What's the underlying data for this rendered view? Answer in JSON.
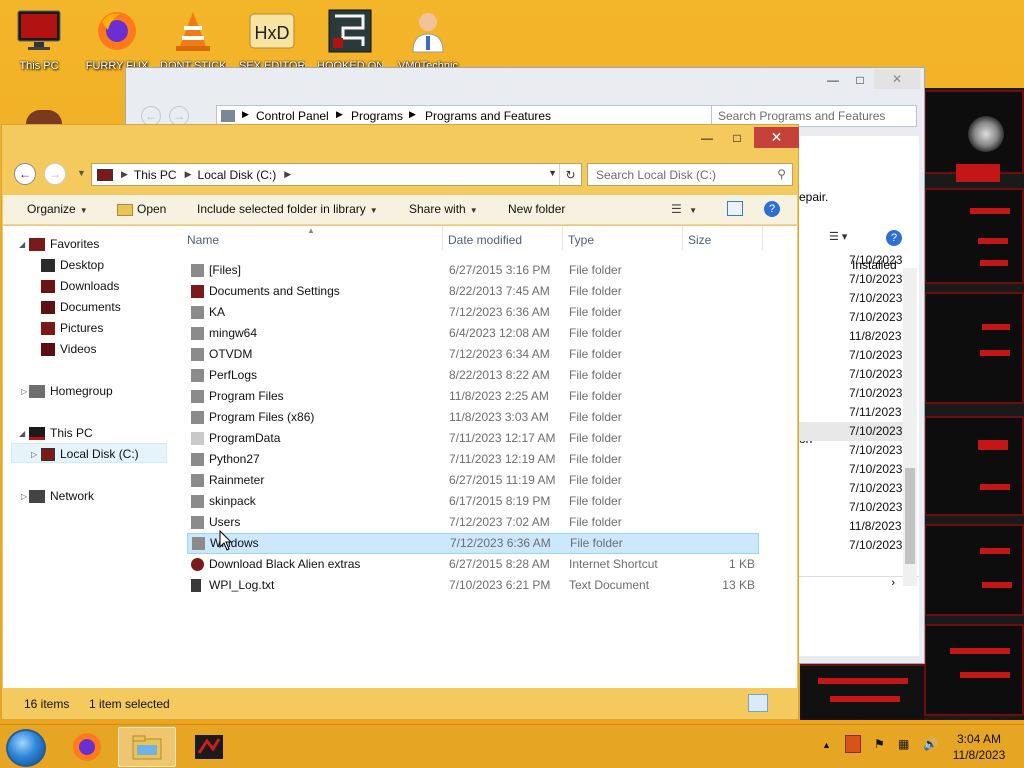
{
  "desktop": {
    "icons": [
      {
        "label": "This PC"
      },
      {
        "label": "FURRY FUX"
      },
      {
        "label": "DONT STICK"
      },
      {
        "label": "SEX EDITOR"
      },
      {
        "label": "HOOKED ON"
      },
      {
        "label": "VM0Technic"
      }
    ]
  },
  "back_window": {
    "breadcrumb": [
      "Control Panel",
      "Programs",
      "Programs and Features"
    ],
    "search_placeholder": "Search Programs and Features",
    "repair_text": "epair.",
    "column_header": "Installed",
    "partial_text": "on",
    "installed_dates": [
      "7/10/2023",
      "7/10/2023",
      "7/10/2023",
      "7/10/2023",
      "11/8/2023",
      "7/10/2023",
      "7/10/2023",
      "7/10/2023",
      "7/11/2023",
      "7/10/2023",
      "7/10/2023",
      "7/10/2023",
      "7/10/2023",
      "7/10/2023",
      "11/8/2023",
      "7/10/2023"
    ]
  },
  "window": {
    "breadcrumb": [
      "This PC",
      "Local Disk (C:)"
    ],
    "search_placeholder": "Search Local Disk (C:)",
    "toolbar": {
      "organize": "Organize",
      "open": "Open",
      "include": "Include selected folder in library",
      "share": "Share with",
      "new_folder": "New folder"
    },
    "nav": {
      "favorites": "Favorites",
      "desktop": "Desktop",
      "downloads": "Downloads",
      "documents": "Documents",
      "pictures": "Pictures",
      "videos": "Videos",
      "homegroup": "Homegroup",
      "this_pc": "This PC",
      "local_disk": "Local Disk (C:)",
      "network": "Network"
    },
    "columns": {
      "name": "Name",
      "date": "Date modified",
      "type": "Type",
      "size": "Size"
    },
    "files": [
      {
        "name": "[Files]",
        "date": "6/27/2015 3:16 PM",
        "type": "File folder",
        "size": ""
      },
      {
        "name": "Documents and Settings",
        "date": "8/22/2013 7:45 AM",
        "type": "File folder",
        "size": ""
      },
      {
        "name": "KA",
        "date": "7/12/2023 6:36 AM",
        "type": "File folder",
        "size": ""
      },
      {
        "name": "mingw64",
        "date": "6/4/2023 12:08 AM",
        "type": "File folder",
        "size": ""
      },
      {
        "name": "OTVDM",
        "date": "7/12/2023 6:34 AM",
        "type": "File folder",
        "size": ""
      },
      {
        "name": "PerfLogs",
        "date": "8/22/2013 8:22 AM",
        "type": "File folder",
        "size": ""
      },
      {
        "name": "Program Files",
        "date": "11/8/2023 2:25 AM",
        "type": "File folder",
        "size": ""
      },
      {
        "name": "Program Files (x86)",
        "date": "11/8/2023 3:03 AM",
        "type": "File folder",
        "size": ""
      },
      {
        "name": "ProgramData",
        "date": "7/11/2023 12:17 AM",
        "type": "File folder",
        "size": ""
      },
      {
        "name": "Python27",
        "date": "7/11/2023 12:19 AM",
        "type": "File folder",
        "size": ""
      },
      {
        "name": "Rainmeter",
        "date": "6/27/2015 11:19 AM",
        "type": "File folder",
        "size": ""
      },
      {
        "name": "skinpack",
        "date": "6/17/2015 8:19 PM",
        "type": "File folder",
        "size": ""
      },
      {
        "name": "Users",
        "date": "7/12/2023 7:02 AM",
        "type": "File folder",
        "size": ""
      },
      {
        "name": "Windows",
        "date": "7/12/2023 6:36 AM",
        "type": "File folder",
        "size": ""
      },
      {
        "name": "Download Black Alien extras",
        "date": "6/27/2015 8:28 AM",
        "type": "Internet Shortcut",
        "size": "1 KB"
      },
      {
        "name": "WPI_Log.txt",
        "date": "7/10/2023 6:21 PM",
        "type": "Text Document",
        "size": "13 KB"
      }
    ],
    "status": {
      "items": "16 items",
      "selected": "1 item selected"
    }
  },
  "taskbar": {
    "time": "3:04 AM",
    "date": "11/8/2023"
  },
  "colors": {
    "window_frame": "#f4ca5e",
    "selection": "#cce8ff",
    "close_button": "#c7413b",
    "taskbar": "#e6a624"
  }
}
